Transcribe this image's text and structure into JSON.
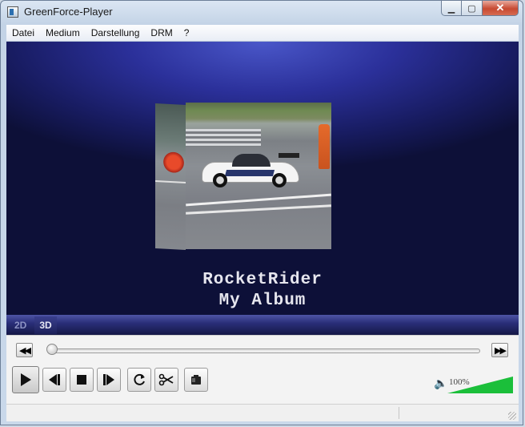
{
  "window": {
    "title": "GreenForce-Player",
    "icon": "app-icon",
    "controls": {
      "minimize": "minimize-icon",
      "maximize": "maximize-icon",
      "close": "close-icon"
    }
  },
  "menu": {
    "items": [
      "Datei",
      "Medium",
      "Darstellung",
      "DRM",
      "?"
    ]
  },
  "video": {
    "artist": "RocketRider",
    "album": "My Album"
  },
  "view_modes": {
    "items": [
      "2D",
      "3D"
    ],
    "active": "3D"
  },
  "transport": {
    "rewind_icon": "rewind-icon",
    "forward_icon": "fast-forward-icon",
    "seek_progress": 0,
    "buttons": [
      "play-icon",
      "previous-icon",
      "stop-icon",
      "next-icon",
      "repeat-icon",
      "cut-icon",
      "snapshot-icon"
    ]
  },
  "volume": {
    "icon": "speaker-icon",
    "label": "100%",
    "level": 1.0,
    "color": "#1bbf3a"
  },
  "status": {
    "left": "",
    "right": ""
  }
}
